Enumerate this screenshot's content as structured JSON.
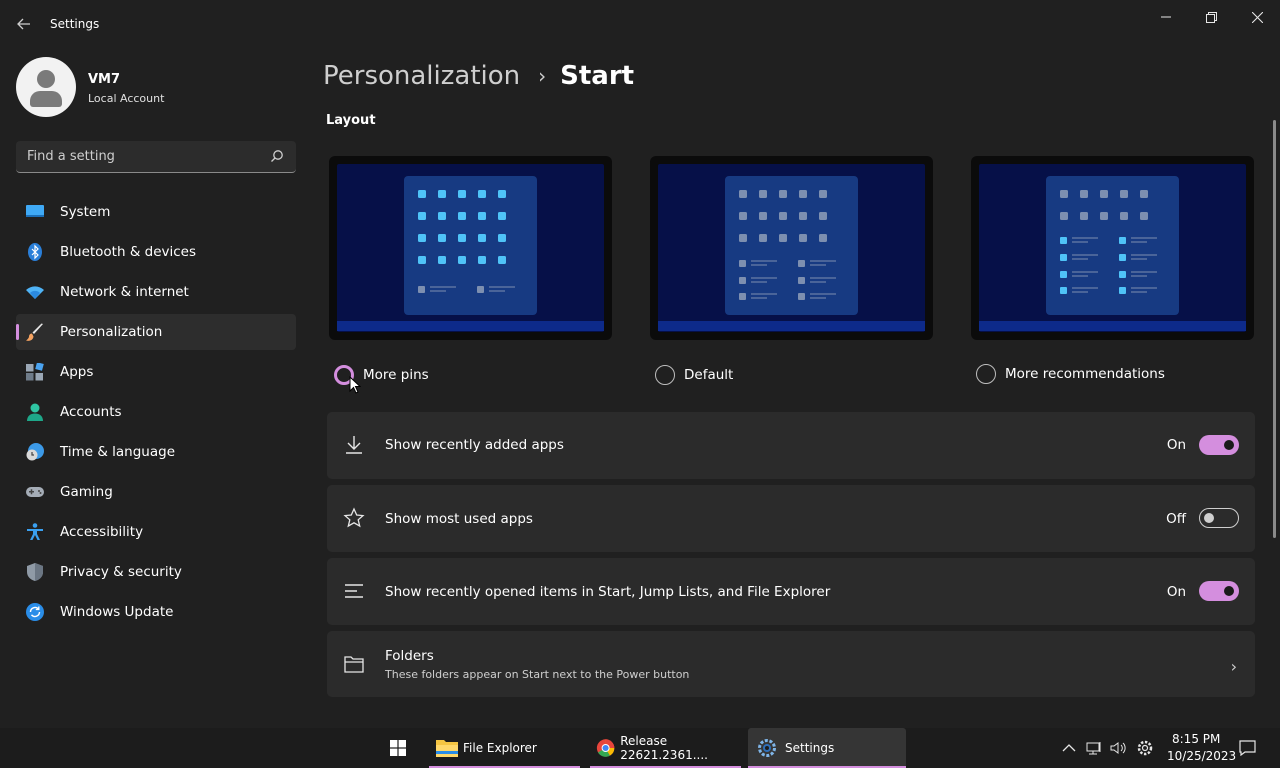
{
  "app": {
    "title": "Settings"
  },
  "profile": {
    "name": "VM7",
    "account_type": "Local Account"
  },
  "search": {
    "placeholder": "Find a setting"
  },
  "sidebar": {
    "items": [
      {
        "label": "System",
        "icon": "system-icon"
      },
      {
        "label": "Bluetooth & devices",
        "icon": "bluetooth-icon"
      },
      {
        "label": "Network & internet",
        "icon": "wifi-icon"
      },
      {
        "label": "Personalization",
        "icon": "paintbrush-icon",
        "active": true
      },
      {
        "label": "Apps",
        "icon": "apps-icon"
      },
      {
        "label": "Accounts",
        "icon": "person-icon"
      },
      {
        "label": "Time & language",
        "icon": "globe-clock-icon"
      },
      {
        "label": "Gaming",
        "icon": "gamepad-icon"
      },
      {
        "label": "Accessibility",
        "icon": "accessibility-icon"
      },
      {
        "label": "Privacy & security",
        "icon": "shield-icon"
      },
      {
        "label": "Windows Update",
        "icon": "update-icon"
      }
    ]
  },
  "breadcrumb": {
    "parent": "Personalization",
    "separator": "›",
    "current": "Start"
  },
  "layout_section": {
    "title": "Layout",
    "options": [
      {
        "label": "More pins",
        "selected": false
      },
      {
        "label": "Default",
        "selected": false
      },
      {
        "label": "More recommendations",
        "selected": false
      }
    ]
  },
  "settings": {
    "recent_apps": {
      "label": "Show recently added apps",
      "state": "On"
    },
    "most_used": {
      "label": "Show most used apps",
      "state": "Off"
    },
    "recent_items": {
      "label": "Show recently opened items in Start, Jump Lists, and File Explorer",
      "state": "On"
    },
    "folders": {
      "label": "Folders",
      "description": "These folders appear on Start next to the Power button"
    }
  },
  "taskbar": {
    "apps": [
      {
        "label": "File Explorer"
      },
      {
        "label": "Release 22621.2361...."
      },
      {
        "label": "Settings",
        "active": true
      }
    ],
    "clock": {
      "time": "8:15 PM",
      "date": "10/25/2023"
    }
  },
  "colors": {
    "accent": "#d48ede",
    "background": "#202020",
    "card": "#2b2b2b"
  }
}
